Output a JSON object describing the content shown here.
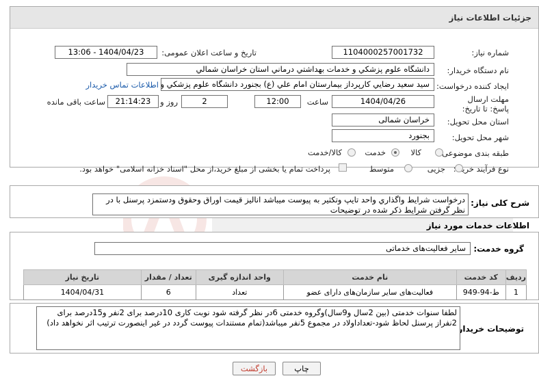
{
  "header": {
    "title": "جزئیات اطلاعات نیاز"
  },
  "fields": {
    "need_number_label": "شماره نیاز:",
    "need_number": "1104000257001732",
    "announce_label": "تاریخ و ساعت اعلان عمومی:",
    "announce_value": "1404/04/23 - 13:06",
    "buyer_org_label": "نام دستگاه خریدار:",
    "buyer_org": "دانشگاه علوم پزشكي و خدمات بهداشتي درماني استان خراسان شمالي",
    "creator_label": "ایجاد کننده درخواست:",
    "creator": "سيد سعيد رضايي كارپرداز بيمارستان امام علي (ع) بجنورد دانشگاه علوم پزشكي و خدمات بهداشتي",
    "contact_link": "اطلاعات تماس خریدار",
    "deadline_label": "مهلت ارسال پاسخ: تا تاریخ:",
    "deadline_date": "1404/04/26",
    "time_label": "ساعت",
    "deadline_time": "12:00",
    "days_value": "2",
    "days_label": "روز و",
    "remaining_time": "21:14:23",
    "remaining_label": "ساعت باقی مانده",
    "province_label": "استان محل تحویل:",
    "province": "خراسان شمالی",
    "city_label": "شهر محل تحویل:",
    "city": "بجنورد",
    "category_label": "طبقه بندی موضوعی:",
    "category_options": [
      "کالا",
      "خدمت",
      "کالا/خدمت"
    ],
    "category_selected": 1,
    "process_label": "نوع فرآیند خرید :",
    "process_options": [
      "جزیی",
      "متوسط"
    ],
    "process_selected": -1,
    "payment_note": "پرداخت تمام یا بخشی از مبلغ خرید،از محل \"اسناد خزانه اسلامی\" خواهد بود."
  },
  "description": {
    "label": "شرح کلی نیاز:",
    "text": "درخواست شرايط واگذاري واحد تايپ وتكثير به پيوست ميباشد  انالیز قیمت اوراق وحقوق ودستمزد پرسنل با در نظر گرفتن شرایط ذکر شده در توضیحات"
  },
  "services": {
    "section_title": "اطلاعات خدمات مورد نیاز",
    "group_label": "گروه خدمت:",
    "group_value": "سایر فعالیت‌های خدماتی",
    "columns": [
      "ردیف",
      "کد خدمت",
      "نام خدمت",
      "واحد اندازه گیری",
      "تعداد / مقدار",
      "تاریخ نیاز"
    ],
    "rows": [
      [
        "1",
        "ط-94-949",
        "فعالیت‌های سایر سازمان‌های دارای عضو",
        "تعداد",
        "6",
        "1404/04/31"
      ]
    ]
  },
  "notes": {
    "label": "توضیحات خریدار:",
    "text": "لطفا سنوات خدمتی (بین 2سال و9سال)وگروه خدمتی 6در نظر گرفته شود نوبت کاری 10درصد برای 2نفر و15درصد برای 2نفراز پرسنل لحاظ شود-تعداداولاد در مجموع 5نفر میباشد(تمام مستندات پیوست گردد در غیر اینصورت ترتیب اثر نخواهد داد)"
  },
  "buttons": {
    "print": "چاپ",
    "back": "بازگشت"
  },
  "colors": {
    "back_button_text": "#c0392b",
    "link": "#1a5aaa"
  }
}
